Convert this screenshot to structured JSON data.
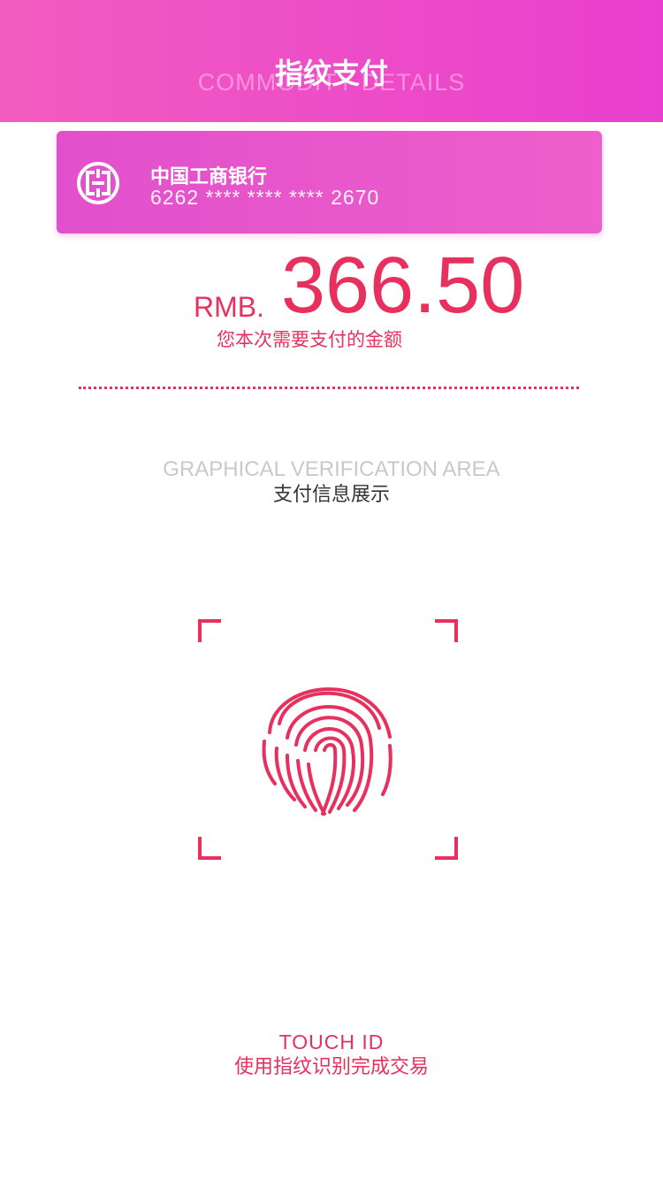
{
  "header": {
    "title": "指纹支付",
    "subtitle": "COMMODITY DETAILS"
  },
  "card": {
    "bank_name": "中国工商银行",
    "card_number": "6262 **** **** **** 2670",
    "icon": "icbc-logo"
  },
  "payment": {
    "currency": "RMB.",
    "amount": "366.50",
    "label": "您本次需要支付的金额"
  },
  "graphic_area": {
    "subtitle": "GRAPHICAL VERIFICATION AREA",
    "title": "支付信息展示"
  },
  "touch": {
    "icon": "fingerprint-icon",
    "subtitle": "TOUCH ID",
    "title": "使用指纹识别完成交易"
  },
  "colors": {
    "header_gradient_start": "#f25cbf",
    "header_gradient_end": "#e93fcf",
    "accent": "#e8305f",
    "card": "#e752cc"
  }
}
